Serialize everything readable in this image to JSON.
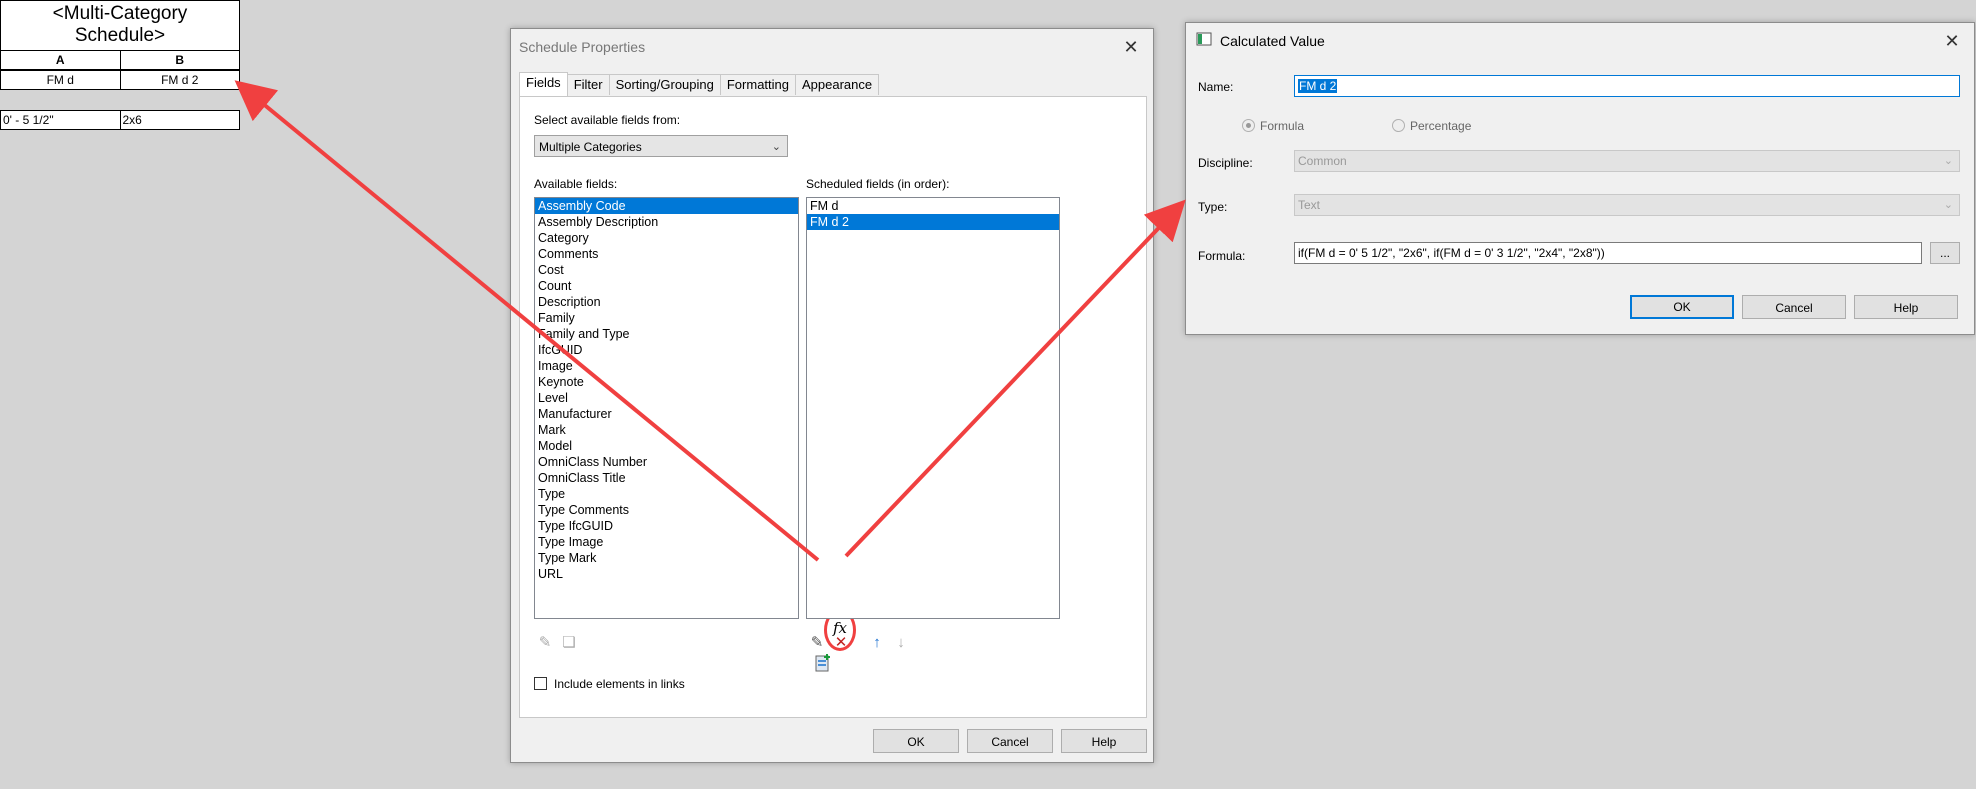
{
  "schedule": {
    "title": "<Multi-Category Schedule>",
    "col_a": "A",
    "col_b": "B",
    "name_a": "FM d",
    "name_b": "FM d 2",
    "row_a": "0' - 5 1/2\"",
    "row_b": "2x6"
  },
  "schedule_properties": {
    "title": "Schedule Properties",
    "close": "✕",
    "tabs": [
      "Fields",
      "Filter",
      "Sorting/Grouping",
      "Formatting",
      "Appearance"
    ],
    "select_label": "Select available fields from:",
    "select_value": "Multiple Categories",
    "available_label": "Available fields:",
    "available_fields": [
      "Assembly Code",
      "Assembly Description",
      "Category",
      "Comments",
      "Cost",
      "Count",
      "Description",
      "Family",
      "Family and Type",
      "IfcGUID",
      "Image",
      "Keynote",
      "Level",
      "Manufacturer",
      "Mark",
      "Model",
      "OmniClass Number",
      "OmniClass Title",
      "Type",
      "Type Comments",
      "Type IfcGUID",
      "Type Image",
      "Type Mark",
      "URL"
    ],
    "scheduled_label": "Scheduled fields (in order):",
    "scheduled_fields": [
      "FM d",
      "FM d 2"
    ],
    "include_links_label": "Include elements in links",
    "ok": "OK",
    "cancel": "Cancel",
    "help": "Help"
  },
  "calculated_value": {
    "title": "Calculated Value",
    "close": "✕",
    "name_label": "Name:",
    "name_value": "FM d 2",
    "formula_radio": "Formula",
    "percentage_radio": "Percentage",
    "discipline_label": "Discipline:",
    "discipline_value": "Common",
    "type_label": "Type:",
    "type_value": "Text",
    "formula_label": "Formula:",
    "formula_value": "if(FM d = 0'  5 1/2\", \"2x6\", if(FM d = 0'  3 1/2\", \"2x4\", \"2x8\"))",
    "browse": "...",
    "ok": "OK",
    "cancel": "Cancel",
    "help": "Help"
  },
  "annotation": {
    "arrow_color": "#f04040"
  }
}
